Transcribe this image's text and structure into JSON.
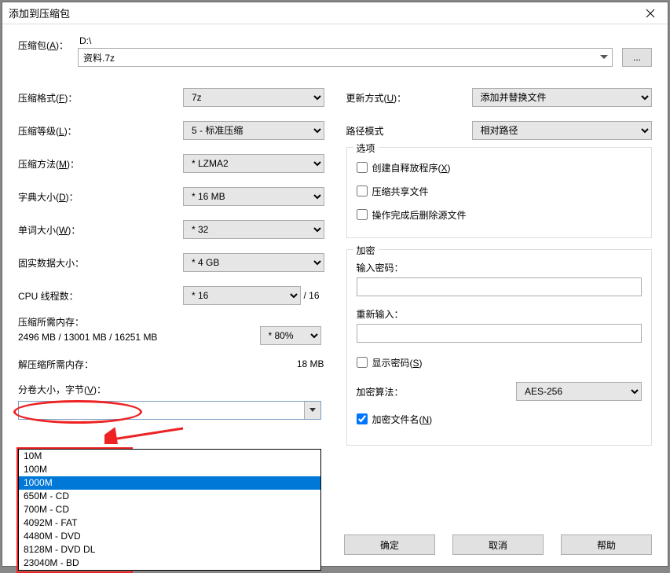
{
  "title": "添加到压缩包",
  "archive": {
    "label_prefix": "压缩包(",
    "label_key": "A",
    "label_suffix": ")：",
    "path": "D:\\",
    "name": "资料.7z",
    "browse": "..."
  },
  "left": {
    "format": {
      "label_prefix": "压缩格式(",
      "label_key": "F",
      "label_suffix": ")：",
      "value": "7z"
    },
    "level": {
      "label_prefix": "压缩等级(",
      "label_key": "L",
      "label_suffix": ")：",
      "value": "5 - 标准压缩"
    },
    "method": {
      "label_prefix": "压缩方法(",
      "label_key": "M",
      "label_suffix": ")：",
      "value": "* LZMA2"
    },
    "dict": {
      "label_prefix": "字典大小(",
      "label_key": "D",
      "label_suffix": ")：",
      "value": "* 16 MB"
    },
    "word": {
      "label_prefix": "单词大小(",
      "label_key": "W",
      "label_suffix": ")：",
      "value": "* 32"
    },
    "solid": {
      "label": "固实数据大小：",
      "value": "* 4 GB"
    },
    "cpu": {
      "label": "CPU 线程数：",
      "value": "* 16",
      "total": "/ 16"
    },
    "compress_mem": {
      "label": "压缩所需内存：",
      "value": "2496 MB / 13001 MB / 16251 MB",
      "pct": "* 80%"
    },
    "decompress_mem": {
      "label": "解压缩所需内存：",
      "value": "18 MB"
    },
    "volume": {
      "label_prefix": "分卷大小，字节(",
      "label_key": "V",
      "label_suffix": ")：",
      "value": ""
    }
  },
  "volume_options": [
    "10M",
    "100M",
    "1000M",
    "650M - CD",
    "700M - CD",
    "4092M - FAT",
    "4480M - DVD",
    "8128M - DVD DL",
    "23040M - BD"
  ],
  "volume_selected_index": 2,
  "right": {
    "update": {
      "label_prefix": "更新方式(",
      "label_key": "U",
      "label_suffix": ")：",
      "value": "添加并替换文件"
    },
    "pathmode": {
      "label": "路径模式",
      "value": "相对路径"
    },
    "options_legend": "选项",
    "opt_sfx": {
      "text_prefix": "创建自释放程序(",
      "text_key": "X",
      "text_suffix": ")"
    },
    "opt_share": {
      "text": "压缩共享文件"
    },
    "opt_delete": {
      "text": "操作完成后删除源文件"
    },
    "encrypt_legend": "加密",
    "pwd1": "输入密码：",
    "pwd2": "重新输入：",
    "show_pwd": {
      "text_prefix": "显示密码(",
      "text_key": "S",
      "text_suffix": ")"
    },
    "enc_algo": {
      "label": "加密算法：",
      "value": "AES-256"
    },
    "enc_names": {
      "text_prefix": "加密文件名(",
      "text_key": "N",
      "text_suffix": ")",
      "checked": true
    }
  },
  "buttons": {
    "ok": "确定",
    "cancel": "取消",
    "help": "帮助"
  }
}
